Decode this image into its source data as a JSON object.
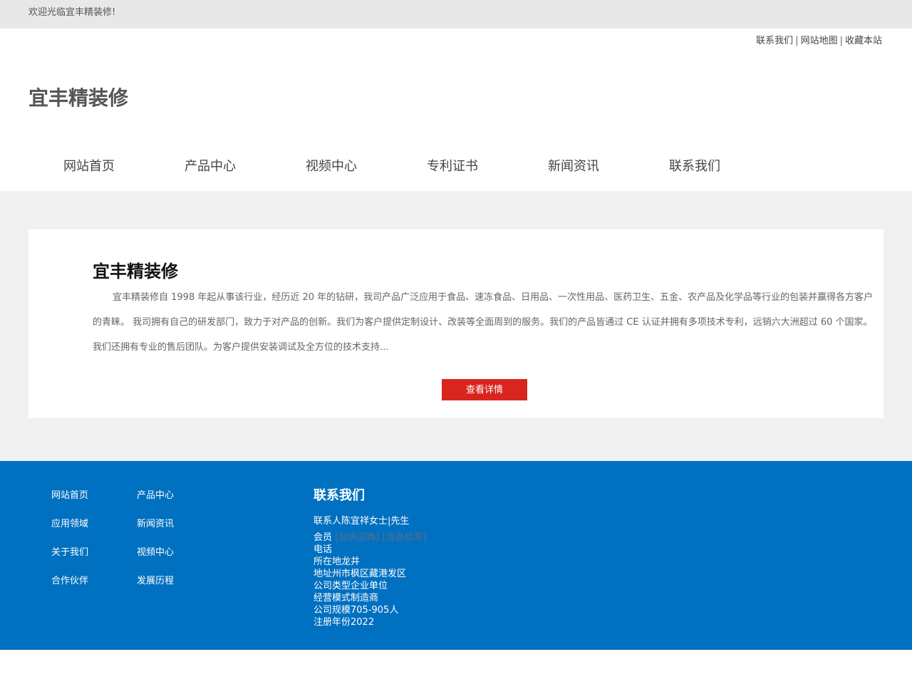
{
  "topbar": {
    "welcome": "欢迎光临宜丰精装修!"
  },
  "top_links": [
    {
      "label": "联系我们"
    },
    {
      "label": "网站地图"
    },
    {
      "label": "收藏本站"
    }
  ],
  "top_links_separator": "|",
  "logo": {
    "text": "宜丰精装修"
  },
  "nav": [
    {
      "label": "网站首页"
    },
    {
      "label": "产品中心"
    },
    {
      "label": "视频中心"
    },
    {
      "label": "专利证书"
    },
    {
      "label": "新闻资讯"
    },
    {
      "label": "联系我们"
    }
  ],
  "intro": {
    "title": "宜丰精装修",
    "text": "宜丰精装修自 1998 年起从事该行业，经历近 20 年的钻研，我司产品广泛应用于食品、速冻食品、日用品、一次性用品、医药卫生、五金、农产品及化学品等行业的包装并赢得各方客户的青睐。 我司拥有自己的研发部门，致力于对产品的创新。我们为客户提供定制设计、改装等全面周到的服务。我们的产品皆通过 CE 认证并拥有多项技术专利，远销六大洲超过 60 个国家。我们还拥有专业的售后团队。为客户提供安装调试及全方位的技术支持...",
    "button": "查看详情"
  },
  "footer": {
    "links_col1": [
      "网站首页",
      "应用领域",
      "关于我们",
      "合作伙伴"
    ],
    "links_col2": [
      "产品中心",
      "新闻资讯",
      "视频中心",
      "发展历程"
    ],
    "contact_title": "联系我们",
    "contact_person": "联系人陈宜祥女士|先生",
    "member_label": "会员",
    "member_value": "[加供应商] [信息检测]",
    "phone": "电话",
    "location": "所在地龙井",
    "address": "地址州市枫区藏港发区",
    "company_type": "公司类型企业单位",
    "business_mode": "经营模式制造商",
    "company_size": "公司规模705-905人",
    "reg_year": "注册年份2022"
  },
  "colors": {
    "topbar_bg": "#e8e8e8",
    "main_bg": "#f1f1f1",
    "button_red": "#d8261f",
    "footer_blue": "#0070c0"
  }
}
